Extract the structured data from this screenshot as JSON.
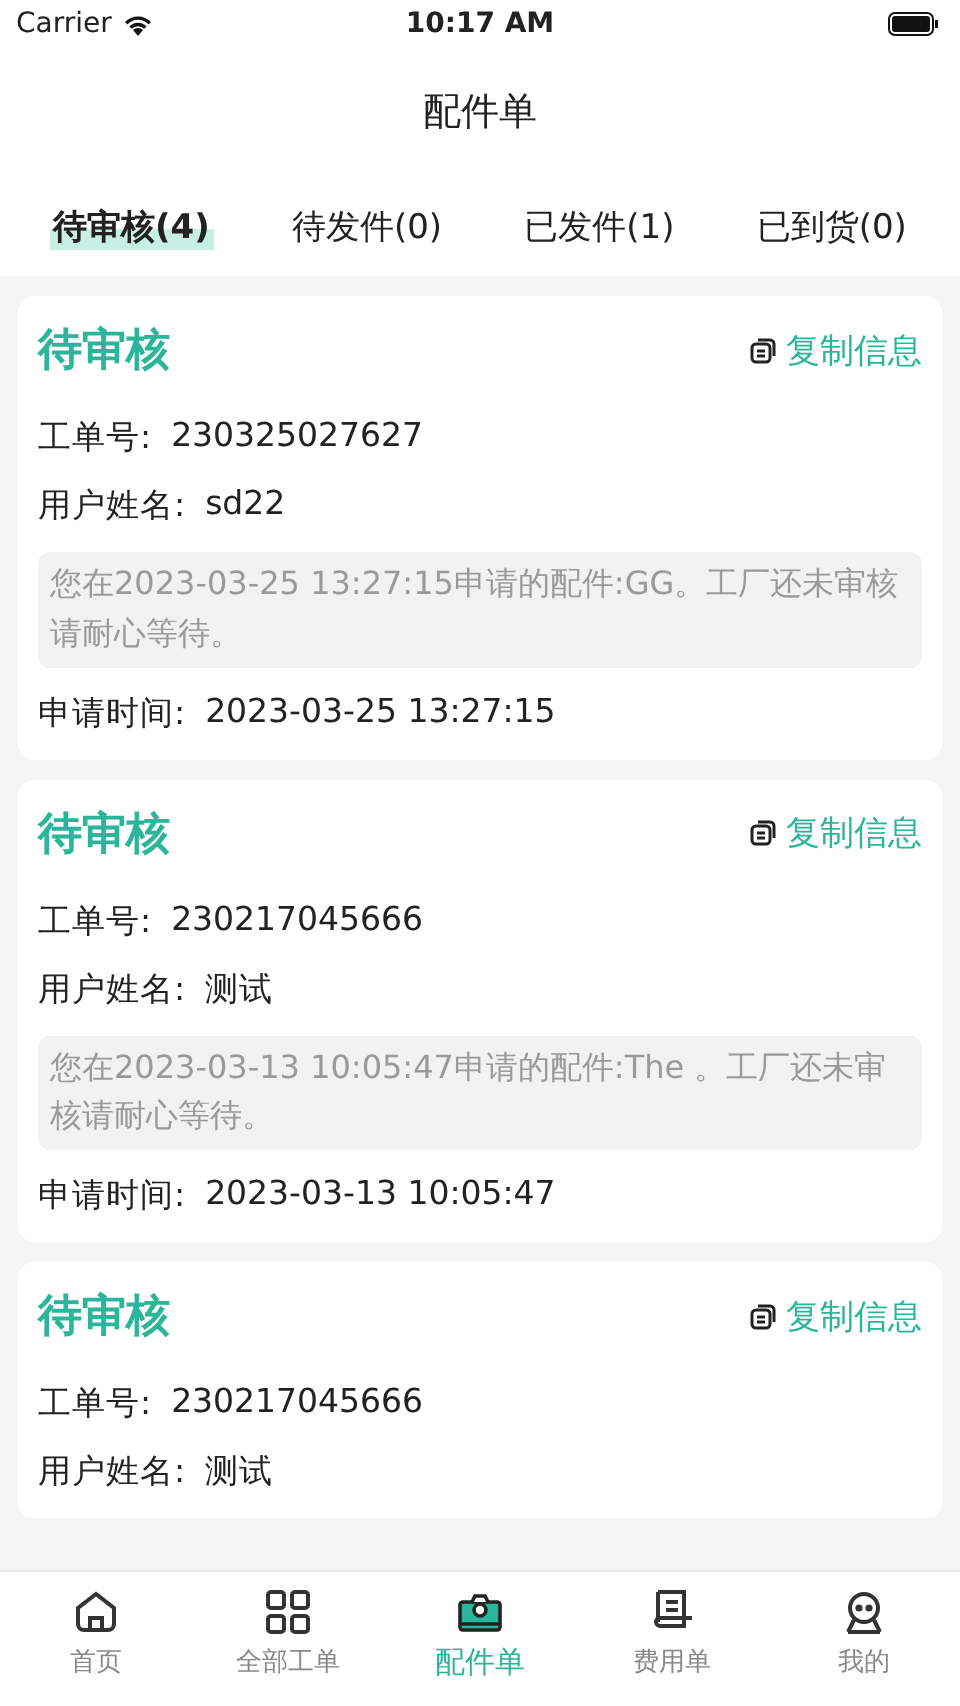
{
  "status_bar": {
    "carrier": "Carrier",
    "time": "10:17 AM"
  },
  "nav": {
    "title": "配件单"
  },
  "tabs": [
    {
      "label": "待审核(4)",
      "selected": true
    },
    {
      "label": "待发件(0)",
      "selected": false
    },
    {
      "label": "已发件(1)",
      "selected": false
    },
    {
      "label": "已到货(0)",
      "selected": false
    }
  ],
  "orders": [
    {
      "status": "待审核",
      "copy": "复制信息",
      "order_no_label": "工单号:",
      "order_no": "230325027627",
      "user_label": "用户姓名:",
      "user": "sd22",
      "message": "您在2023-03-25 13:27:15申请的配件:GG。工厂还未审核请耐心等待。",
      "time_label": "申请时间:",
      "time": "2023-03-25 13:27:15"
    },
    {
      "status": "待审核",
      "copy": "复制信息",
      "order_no_label": "工单号:",
      "order_no": "230217045666",
      "user_label": "用户姓名:",
      "user": "测试",
      "message": "您在2023-03-13 10:05:47申请的配件:The 。工厂还未审核请耐心等待。",
      "time_label": "申请时间:",
      "time": "2023-03-13 10:05:47"
    },
    {
      "status": "待审核",
      "copy": "复制信息",
      "order_no_label": "工单号:",
      "order_no": "230217045666",
      "user_label": "用户姓名:",
      "user": "测试"
    }
  ],
  "tab_bar": [
    {
      "label": "首页",
      "kind": "home",
      "selected": false
    },
    {
      "label": "全部工单",
      "kind": "grid",
      "selected": false
    },
    {
      "label": "配件单",
      "kind": "parts",
      "selected": true
    },
    {
      "label": "费用单",
      "kind": "bill",
      "selected": false
    },
    {
      "label": "我的",
      "kind": "profile",
      "selected": false
    }
  ]
}
